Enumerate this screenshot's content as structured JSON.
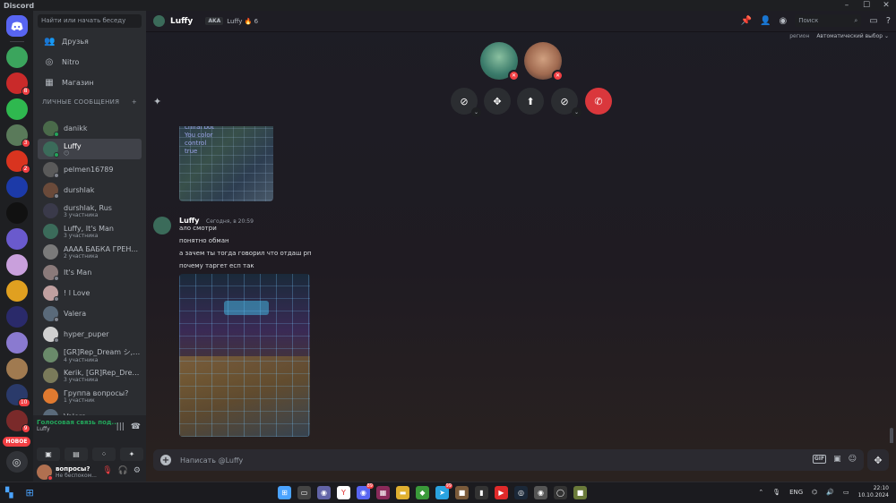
{
  "window": {
    "title": "Discord",
    "controls": [
      "–",
      "☐",
      "✕"
    ]
  },
  "servers": {
    "items": [
      {
        "name": "server-1",
        "color": "#3ba55d",
        "badge": ""
      },
      {
        "name": "server-2",
        "color": "#c92a2a",
        "badge": "8"
      },
      {
        "name": "server-3",
        "color": "#2fb84f",
        "badge": ""
      },
      {
        "name": "server-4",
        "color": "#5a7a5a",
        "badge": "3"
      },
      {
        "name": "server-5",
        "color": "#d9341f",
        "badge": "2"
      },
      {
        "name": "server-6",
        "color": "#1c3aa8",
        "badge": ""
      },
      {
        "name": "server-7",
        "color": "#111111",
        "badge": ""
      },
      {
        "name": "server-8",
        "color": "#6a5acd",
        "badge": ""
      },
      {
        "name": "server-9",
        "color": "#c9a0dc",
        "badge": ""
      },
      {
        "name": "server-10",
        "color": "#e0a020",
        "badge": ""
      },
      {
        "name": "server-11",
        "color": "#2a2a6a",
        "badge": ""
      },
      {
        "name": "server-12",
        "color": "#8a7ad0",
        "badge": ""
      },
      {
        "name": "server-13",
        "color": "#a07a50",
        "badge": ""
      },
      {
        "name": "server-14",
        "color": "#2a3a6a",
        "badge": "10"
      },
      {
        "name": "server-15",
        "color": "#7a2a2a",
        "badge": "9"
      }
    ],
    "new_label": "НОВОЕ"
  },
  "dm": {
    "search_placeholder": "Найти или начать беседу",
    "nav": [
      {
        "icon": "👥",
        "label": "Друзья"
      },
      {
        "icon": "◎",
        "label": "Nitro"
      },
      {
        "icon": "▦",
        "label": "Магазин"
      }
    ],
    "section_label": "ЛИЧНЫЕ СООБЩЕНИЯ",
    "section_add": "+",
    "items": [
      {
        "name": "danikk",
        "sub": "",
        "color": "#4a6a4a",
        "status": "on"
      },
      {
        "name": "Luffy",
        "sub": "😶",
        "color": "#3b6b5a",
        "status": "on",
        "active": true
      },
      {
        "name": "pelmen16789",
        "sub": "",
        "color": "#5a5a5a",
        "status": "off"
      },
      {
        "name": "durshlak",
        "sub": "",
        "color": "#6a4a3a",
        "status": "off"
      },
      {
        "name": "durshlak, Rus",
        "sub": "3 участника",
        "color": "#3a3a4a",
        "status": "none"
      },
      {
        "name": "Luffy, It's Man",
        "sub": "3 участника",
        "color": "#3b6b5a",
        "status": "none"
      },
      {
        "name": "АААА БАБКА ГРЕН...",
        "sub": "2 участника",
        "color": "#7a7a7a",
        "status": "none"
      },
      {
        "name": "It's Man",
        "sub": "",
        "color": "#8a7a7a",
        "status": "off"
      },
      {
        "name": "! l Love",
        "sub": "",
        "color": "#c0a0a0",
        "status": "off"
      },
      {
        "name": "Valera",
        "sub": "",
        "color": "#5a6a7a",
        "status": "off"
      },
      {
        "name": "hyper_puper",
        "sub": "",
        "color": "#d0d0d0",
        "status": "off"
      },
      {
        "name": "[GR]Rep_Dream シ, ко...",
        "sub": "4 участника",
        "color": "#6a8a6a",
        "status": "none"
      },
      {
        "name": "Kerik, [GR]Rep_Drea...",
        "sub": "3 участника",
        "color": "#7a7a5a",
        "status": "none"
      },
      {
        "name": "Группа вопросы?",
        "sub": "1 участник",
        "color": "#e07a30",
        "status": "none"
      },
      {
        "name": "Valera",
        "sub": "",
        "color": "#5a6a7a",
        "status": "off"
      }
    ]
  },
  "voice": {
    "status": "Голосовая связь под...",
    "channel": "Luffy",
    "buttons": [
      "▣",
      "▤",
      "⁘",
      "✦"
    ]
  },
  "user": {
    "name": "вопросы?",
    "status": "Не беспоком...",
    "icons": [
      "🎙",
      "🎧",
      "⚙"
    ]
  },
  "topbar": {
    "name": "Luffy",
    "aka_tag": "AKA",
    "aka_name": "Luffy 🔥 6",
    "search_placeholder": "Поиск",
    "region_label": "регион",
    "region_value": "Автоматический выбор ⌄"
  },
  "call": {
    "controls": [
      {
        "name": "camera-off",
        "glyph": "⊘",
        "chevron": true
      },
      {
        "name": "activities",
        "glyph": "✥",
        "chevron": false
      },
      {
        "name": "screen-share",
        "glyph": "⬆",
        "chevron": false
      },
      {
        "name": "mic-off",
        "glyph": "⊘",
        "chevron": true
      },
      {
        "name": "end-call",
        "glyph": "✆",
        "chevron": false
      }
    ]
  },
  "chat": {
    "old_image_text": "chiral bot\nYou color\ncontrol\ntrue",
    "message": {
      "author": "Luffy",
      "time": "Сегодня, в 20:59",
      "lines": [
        "ало смотри",
        "понятно обман",
        "а зачем ты тогда говорил что отдаш рп",
        "почему таргет есп так"
      ]
    },
    "composer_placeholder": "Написать @Luffy",
    "composer_icons": [
      "GIF",
      "▣",
      "☺"
    ]
  },
  "taskbar": {
    "lang": "ENG",
    "time": "22:10",
    "date": "10.10.2024",
    "apps": [
      {
        "name": "windows",
        "color": "#4aa3ff",
        "glyph": "⊞",
        "badge": ""
      },
      {
        "name": "files",
        "color": "#444",
        "glyph": "▭",
        "badge": ""
      },
      {
        "name": "chat",
        "color": "#6264a7",
        "glyph": "◉",
        "badge": ""
      },
      {
        "name": "yandex",
        "color": "#fff",
        "glyph": "Y",
        "badge": ""
      },
      {
        "name": "discord",
        "color": "#5865f2",
        "glyph": "◉",
        "badge": "89"
      },
      {
        "name": "winrar",
        "color": "#8a2a5a",
        "glyph": "▦",
        "badge": ""
      },
      {
        "name": "explorer",
        "color": "#e0b030",
        "glyph": "▬",
        "badge": ""
      },
      {
        "name": "bluestacks",
        "color": "#3a9a3a",
        "glyph": "◆",
        "badge": ""
      },
      {
        "name": "telegram",
        "color": "#2aa3e0",
        "glyph": "➤",
        "badge": "99"
      },
      {
        "name": "minecraft",
        "color": "#7a5a3a",
        "glyph": "■",
        "badge": ""
      },
      {
        "name": "app-dark",
        "color": "#333",
        "glyph": "▮",
        "badge": ""
      },
      {
        "name": "youtube",
        "color": "#e02a2a",
        "glyph": "▶",
        "badge": ""
      },
      {
        "name": "steam",
        "color": "#1b2838",
        "glyph": "◎",
        "badge": ""
      },
      {
        "name": "apex",
        "color": "#555",
        "glyph": "◉",
        "badge": ""
      },
      {
        "name": "obs",
        "color": "#333",
        "glyph": "◯",
        "badge": ""
      },
      {
        "name": "minecraft-2",
        "color": "#6a7a3a",
        "glyph": "■",
        "badge": ""
      }
    ]
  }
}
